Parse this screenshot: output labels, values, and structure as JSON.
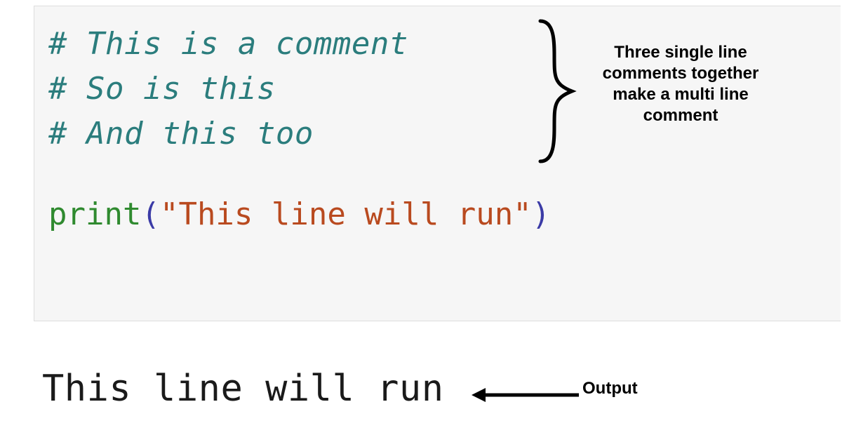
{
  "code": {
    "comment1": "# This is a comment",
    "comment2": "# So is this",
    "comment3": "# And this too",
    "print_fn": "print",
    "paren_open": "(",
    "quote_open": "\"",
    "string_body": "This line will run",
    "quote_close": "\"",
    "paren_close": ")"
  },
  "annotation": {
    "multiline_comment": "Three single line comments together make a multi line comment",
    "output_label": "Output"
  },
  "output": {
    "text": "This line will run"
  }
}
